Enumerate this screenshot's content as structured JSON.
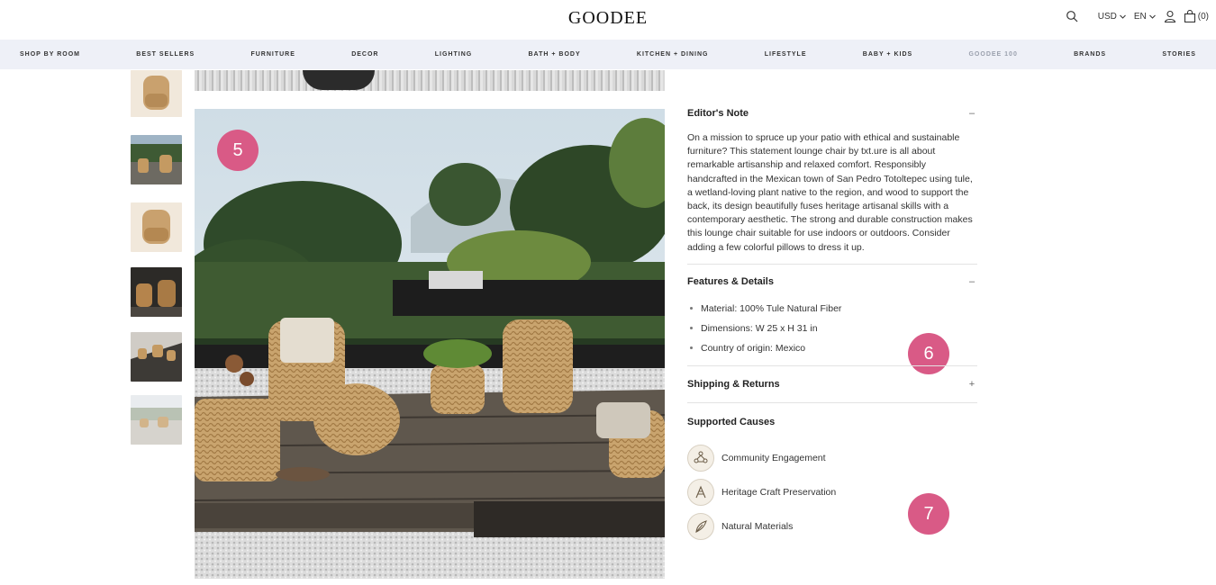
{
  "header": {
    "logo": "GOODEE",
    "currency": "USD",
    "language": "EN",
    "cart_count": "(0)"
  },
  "nav": {
    "items": [
      "SHOP BY ROOM",
      "BEST SELLERS",
      "FURNITURE",
      "DECOR",
      "LIGHTING",
      "BATH + BODY",
      "KITCHEN + DINING",
      "LIFESTYLE",
      "BABY + KIDS",
      "GOODEE 100",
      "BRANDS",
      "STORIES"
    ]
  },
  "annotations": {
    "badge_5": "5",
    "badge_6": "6",
    "badge_7": "7",
    "color": "#d95a86"
  },
  "details": {
    "editors_note": {
      "title": "Editor's Note",
      "toggle": "–",
      "text": "On a mission to spruce up your patio with ethical and sustainable furniture? This statement lounge chair by txt.ure is all about remarkable artisanship and relaxed comfort. Responsibly handcrafted in the Mexican town of San Pedro Totoltepec using tule, a wetland-loving plant native to the region, and wood to support the back, its design beautifully fuses heritage artisanal skills with a contemporary aesthetic. The strong and durable construction makes this lounge chair suitable for use indoors or outdoors. Consider adding a few colorful pillows to dress it up."
    },
    "features": {
      "title": "Features & Details",
      "toggle": "–",
      "items": [
        "Material: 100% Tule Natural Fiber",
        "Dimensions: W 25 x H 31 in",
        "Country of origin: Mexico"
      ]
    },
    "shipping": {
      "title": "Shipping & Returns",
      "toggle": "+"
    },
    "causes": {
      "title": "Supported Causes",
      "items": [
        {
          "label": "Community Engagement",
          "icon": "community-icon"
        },
        {
          "label": "Heritage Craft Preservation",
          "icon": "heritage-craft-icon"
        },
        {
          "label": "Natural Materials",
          "icon": "natural-materials-icon"
        }
      ]
    }
  }
}
